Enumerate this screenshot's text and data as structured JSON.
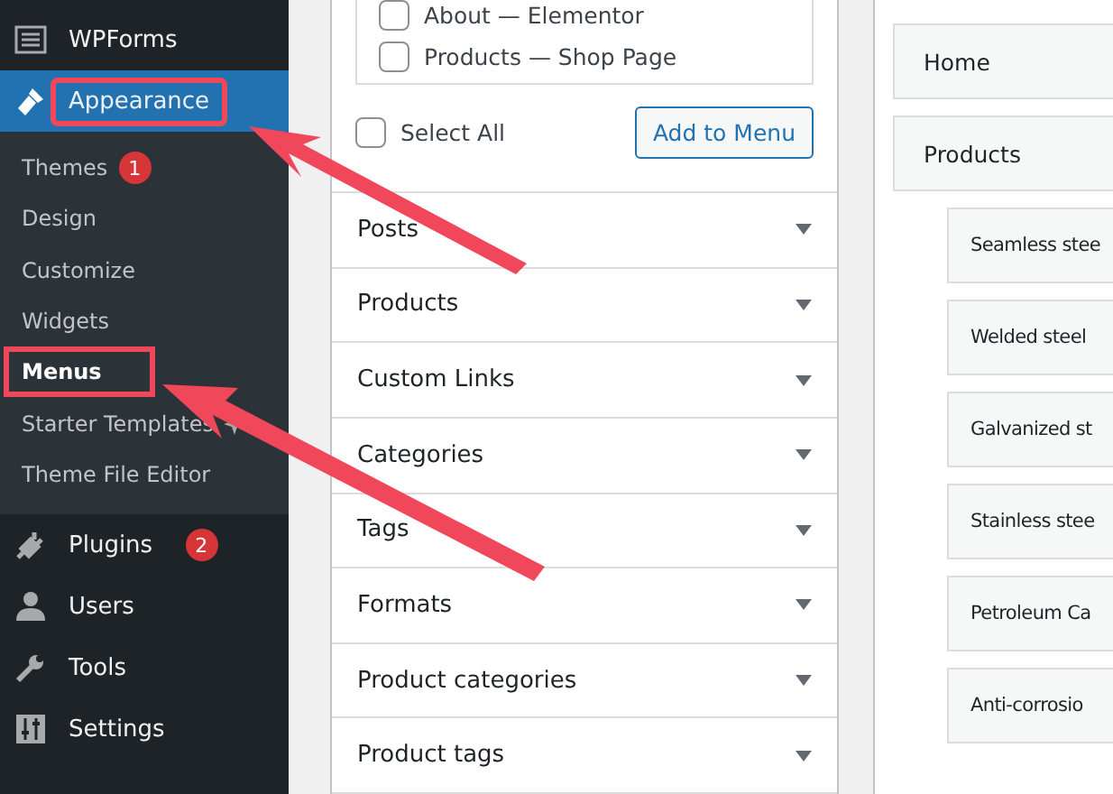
{
  "sidebar": {
    "items": [
      {
        "label": "WPForms",
        "selected": false,
        "highlighted": false
      },
      {
        "label": "Appearance",
        "selected": true,
        "highlighted": true,
        "children": [
          {
            "label": "Themes",
            "badge": "1",
            "selected": false,
            "highlighted": false
          },
          {
            "label": "Design",
            "selected": false,
            "highlighted": false
          },
          {
            "label": "Customize",
            "selected": false,
            "highlighted": false
          },
          {
            "label": "Widgets",
            "selected": false,
            "highlighted": false
          },
          {
            "label": "Menus",
            "selected": true,
            "highlighted": true
          },
          {
            "label": "Starter Templates",
            "selected": false,
            "highlighted": false,
            "extra_icon": true
          },
          {
            "label": "Theme File Editor",
            "selected": false,
            "highlighted": false
          }
        ]
      },
      {
        "label": "Plugins",
        "badge": "2",
        "selected": false,
        "highlighted": false
      },
      {
        "label": "Users",
        "selected": false,
        "highlighted": false
      },
      {
        "label": "Tools",
        "selected": false,
        "highlighted": false
      },
      {
        "label": "Settings",
        "selected": false,
        "highlighted": false
      }
    ]
  },
  "pages_box": {
    "items": [
      {
        "label": "About — Elementor",
        "checked": false
      },
      {
        "label": "Products — Shop Page",
        "checked": false
      }
    ],
    "select_all": {
      "label": "Select All",
      "checked": false
    },
    "add_button": "Add to Menu"
  },
  "sections": [
    "Posts",
    "Products",
    "Custom Links",
    "Categories",
    "Tags",
    "Formats",
    "Product categories",
    "Product tags"
  ],
  "menu_structure": [
    {
      "label": "Home"
    },
    {
      "label": "Products",
      "children": [
        {
          "label": "Seamless stee"
        },
        {
          "label": "Welded steel"
        },
        {
          "label": "Galvanized st"
        },
        {
          "label": "Stainless stee"
        },
        {
          "label": "Petroleum Ca"
        },
        {
          "label": "Anti-corrosio"
        }
      ]
    }
  ]
}
